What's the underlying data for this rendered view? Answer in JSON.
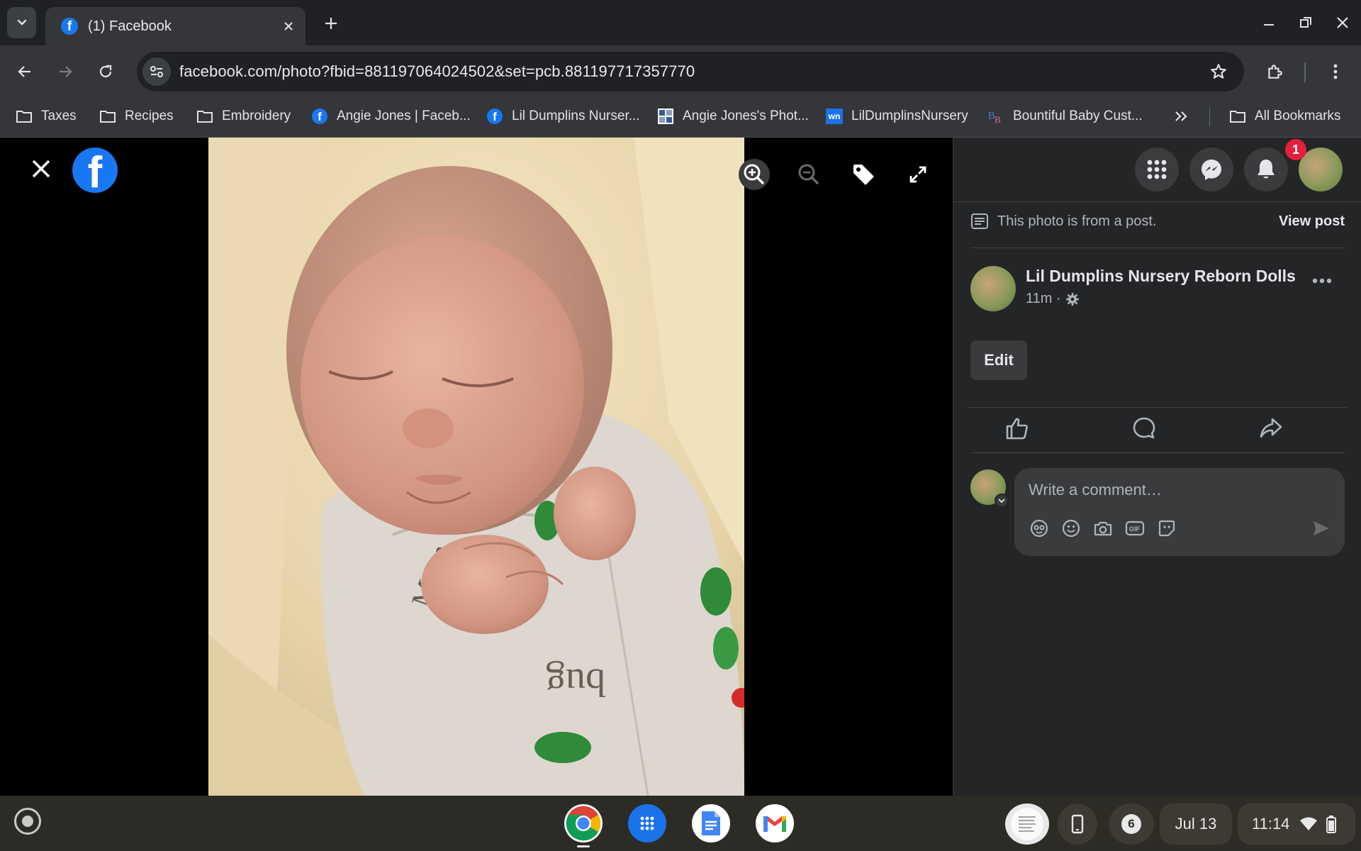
{
  "browser": {
    "tab_title": "(1) Facebook",
    "url": "facebook.com/photo?fbid=881197064024502&set=pcb.881197717357770"
  },
  "bookmarks": [
    {
      "label": "Taxes",
      "icon": "folder-icon"
    },
    {
      "label": "Recipes",
      "icon": "folder-icon"
    },
    {
      "label": "Embroidery",
      "icon": "folder-icon"
    },
    {
      "label": "Angie Jones | Faceb...",
      "icon": "facebook-icon"
    },
    {
      "label": "Lil Dumplins Nurser...",
      "icon": "facebook-icon"
    },
    {
      "label": "Angie Jones's Phot...",
      "icon": "photo-site-icon"
    },
    {
      "label": "LilDumplinsNursery",
      "icon": "wn-icon"
    },
    {
      "label": "Bountiful Baby Cust...",
      "icon": "bb-icon"
    }
  ],
  "bookmarks_all": "All Bookmarks",
  "viewer": {
    "logo_letter": "f"
  },
  "panel": {
    "notification_count": "1",
    "from_post_text": "This photo is from a post.",
    "view_post_label": "View post",
    "author_name": "Lil Dumplins Nursery Reborn Dolls",
    "post_time": "11m ·",
    "edit_label": "Edit",
    "comment_placeholder": "Write a comment…"
  },
  "shelf": {
    "notification_count": "6",
    "date": "Jul 13",
    "time": "11:14"
  },
  "colors": {
    "facebook_blue": "#1877f2",
    "panel_bg": "#242526",
    "badge_red": "#e41e3f"
  }
}
